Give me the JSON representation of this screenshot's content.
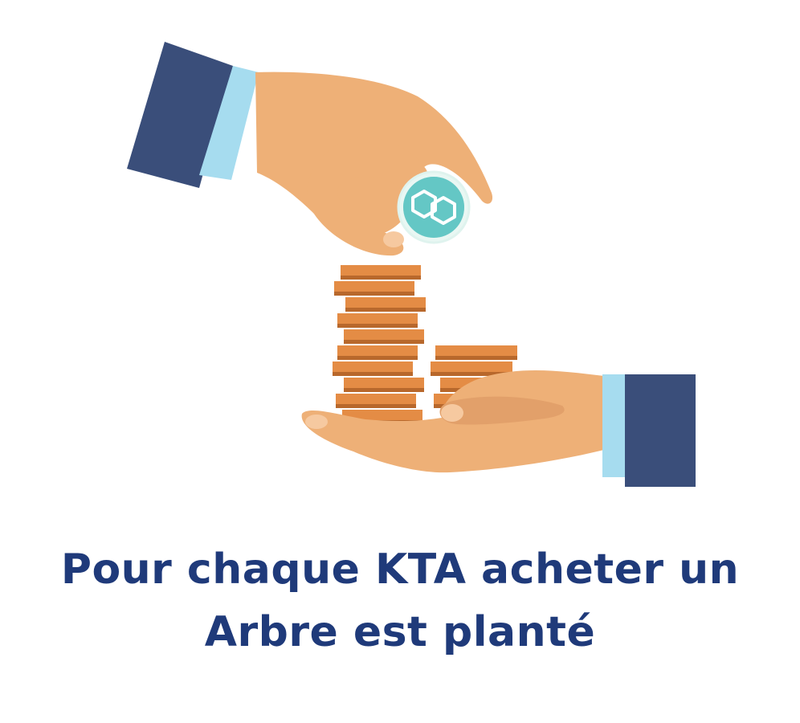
{
  "illustration": {
    "subject": "hand-dropping-coin-on-coin-stack",
    "icon": "kta-token-icon"
  },
  "caption": {
    "line1": "Pour chaque KTA acheter un",
    "line2": "Arbre est planté"
  },
  "colors": {
    "caption": "#1f3a7a",
    "sleeve": "#3a4e7a",
    "cuff": "#a6dcef",
    "skin": "#eeb077",
    "skin_shadow": "#d8945e",
    "coin": "#e48c45",
    "coin_dark": "#b8682c",
    "token": "#5fd0b4"
  }
}
